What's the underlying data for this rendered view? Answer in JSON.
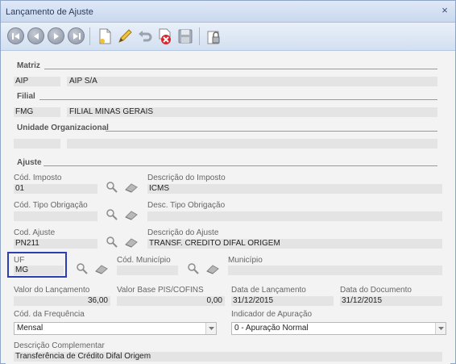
{
  "window": {
    "title": "Lançamento de Ajuste",
    "close_glyph": "×"
  },
  "toolbar": {
    "buttons": [
      "first-icon",
      "previous-icon",
      "next-icon",
      "last-icon",
      "new-document-icon",
      "edit-pencil-icon",
      "undo-icon",
      "delete-icon",
      "save-disk-icon",
      "lock-icon"
    ]
  },
  "matriz": {
    "section": "Matriz",
    "code": "AIP",
    "name": "AIP S/A"
  },
  "filial": {
    "section": "Filial",
    "code": "FMG",
    "name": "FILIAL MINAS GERAIS"
  },
  "unidade": {
    "section": "Unidade Organizacional",
    "code": "",
    "name": ""
  },
  "ajuste": {
    "section": "Ajuste",
    "cod_imposto_label": "Cód. Imposto",
    "cod_imposto": "01",
    "desc_imposto_label": "Descrição do Imposto",
    "desc_imposto": "ICMS",
    "cod_tipo_obrig_label": "Cód. Tipo Obrigação",
    "cod_tipo_obrig": "",
    "desc_tipo_obrig_label": "Desc. Tipo Obrigação",
    "desc_tipo_obrig": "",
    "cod_ajuste_label": "Cod. Ajuste",
    "cod_ajuste": "PN211",
    "desc_ajuste_label": "Descrição do Ajuste",
    "desc_ajuste": "TRANSF. CREDITO DIFAL ORIGEM",
    "uf_label": "UF",
    "uf": "MG",
    "cod_municipio_label": "Cód. Município",
    "cod_municipio": "",
    "municipio_label": "Município",
    "municipio": "",
    "valor_lanc_label": "Valor do Lançamento",
    "valor_lanc": "36,00",
    "valor_base_label": "Valor Base PIS/COFINS",
    "valor_base": "0,00",
    "data_lanc_label": "Data de Lançamento",
    "data_lanc": "31/12/2015",
    "data_doc_label": "Data do Documento",
    "data_doc": "31/12/2015",
    "cod_freq_label": "Cód. da Frequência",
    "cod_freq": "Mensal",
    "ind_apur_label": "Indicador de Apuração",
    "ind_apur": "0 - Apuração Normal",
    "desc_compl_label": "Descrição Complementar",
    "desc_compl": "Transferência de Crédito Difal Origem"
  },
  "colors": {
    "titlebar": "#c9d8ee",
    "uf_highlight": "#2b3fb0",
    "field_bg": "#e4e4e4"
  }
}
